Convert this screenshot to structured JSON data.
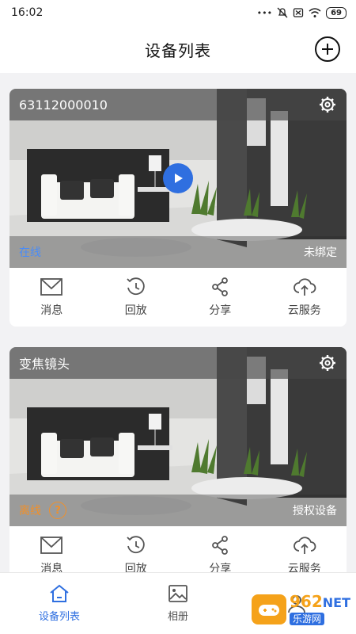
{
  "status": {
    "time": "16:02",
    "battery": "69"
  },
  "header": {
    "title": "设备列表"
  },
  "devices": [
    {
      "name": "63112000010",
      "status": "在线",
      "binding": "未绑定"
    },
    {
      "name": "变焦镜头",
      "status": "离线",
      "binding": "授权设备"
    }
  ],
  "actions": {
    "messages": "消息",
    "playback": "回放",
    "share": "分享",
    "cloud": "云服务"
  },
  "tabs": {
    "devices": "设备列表",
    "album": "相册"
  },
  "watermark": {
    "number": "962",
    "net": "NET",
    "site": "乐游网"
  },
  "colors": {
    "accent": "#2f6fe0",
    "online": "#4a8cf7",
    "offline": "#f0902a"
  }
}
